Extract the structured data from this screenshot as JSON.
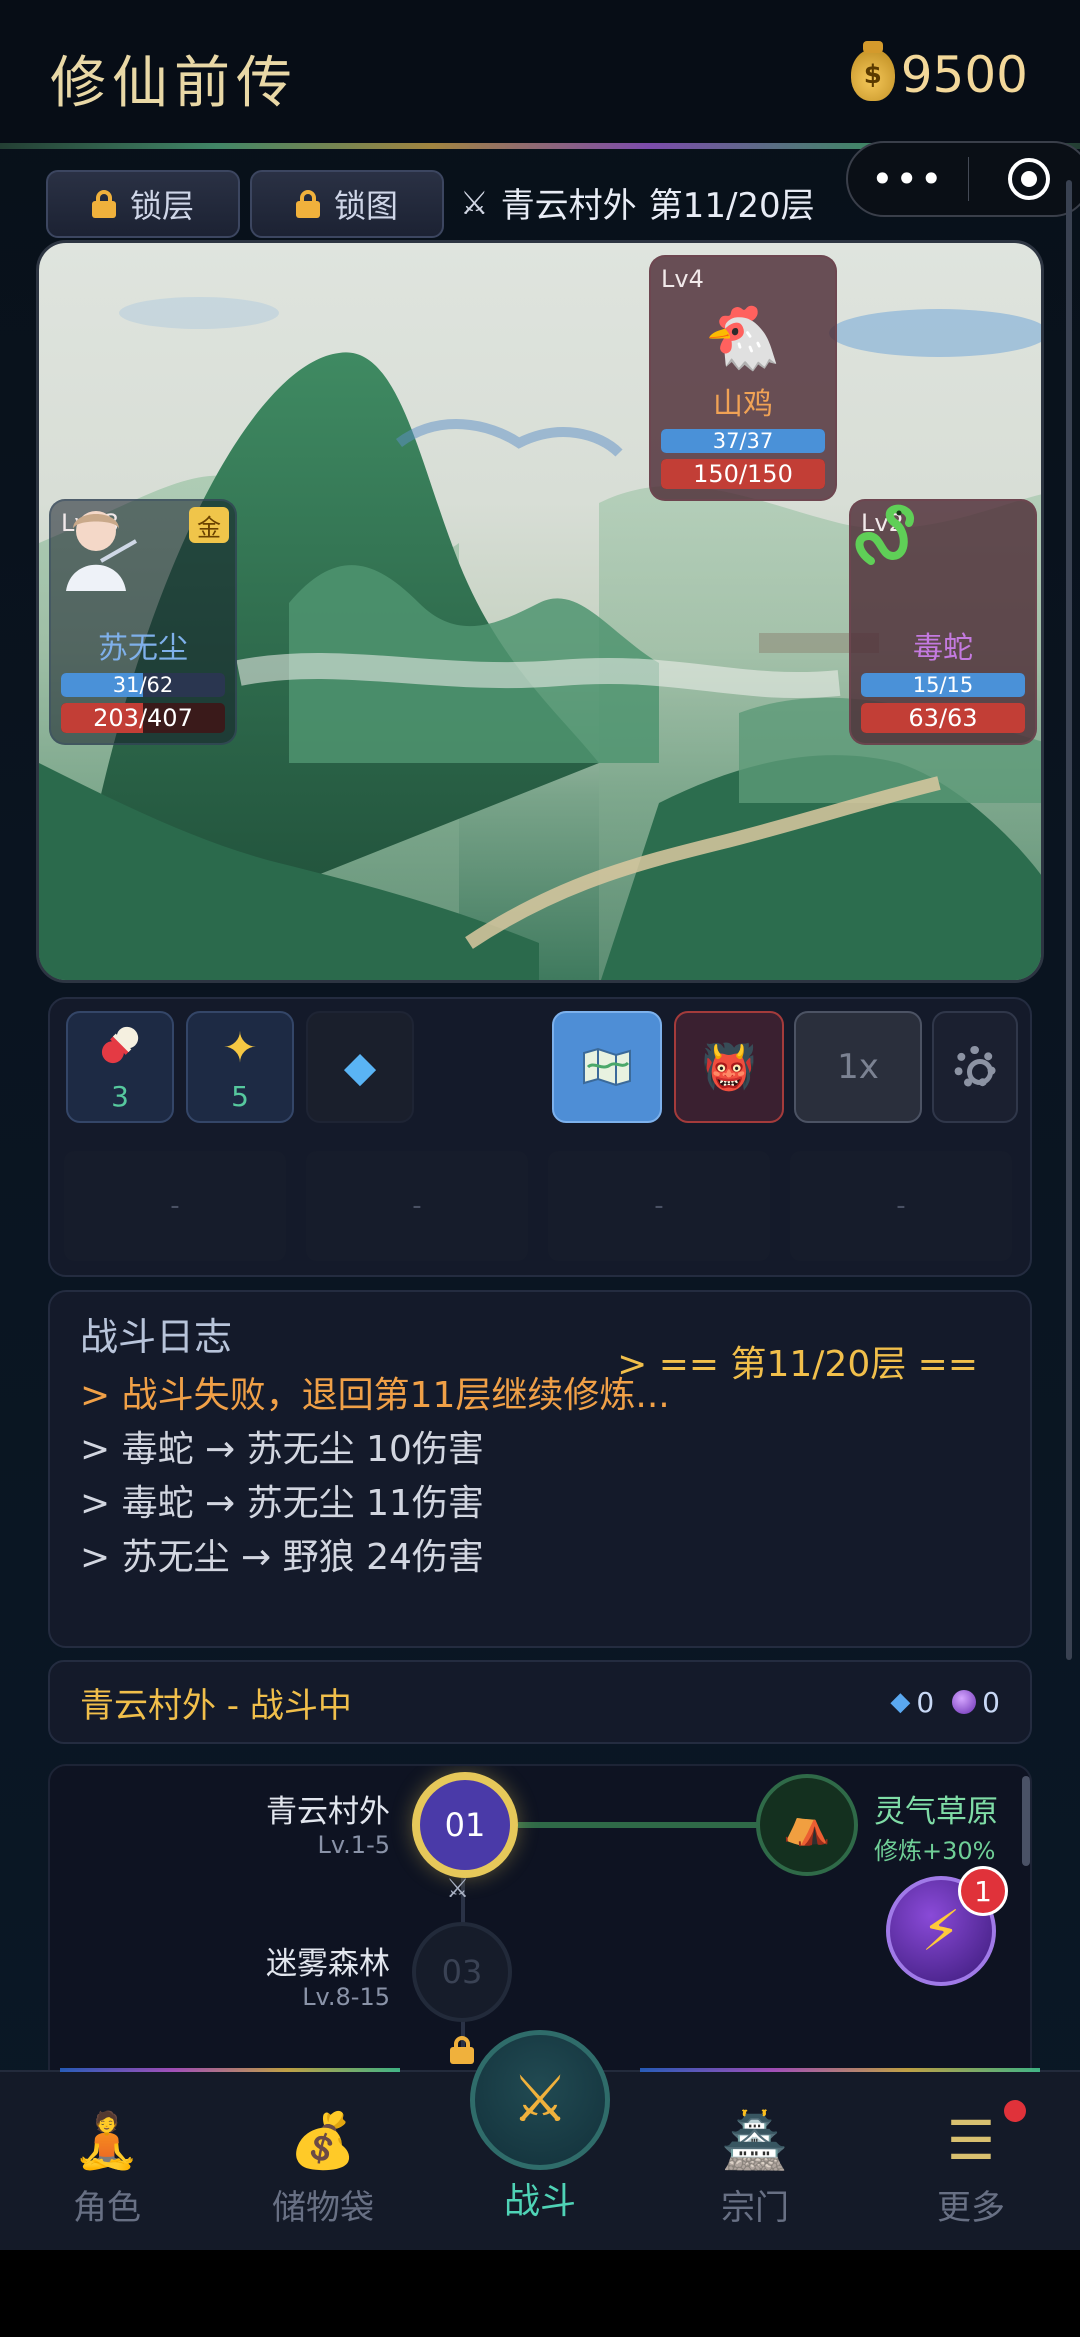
{
  "header": {
    "title": "修仙前传",
    "gold_value": "9500"
  },
  "toolbar": {
    "lock_floor_label": "锁层",
    "lock_map_label": "锁图",
    "location": "青云村外",
    "floor": "第11/20层"
  },
  "capsule": {
    "more_glyph": "•••"
  },
  "scene": {
    "hero": {
      "level": "Lv13",
      "badge": "金",
      "name": "苏无尘",
      "mp_text": "31/62",
      "mp_fraction": 0.5,
      "hp_text": "203/407",
      "hp_fraction": 0.5
    },
    "enemies": [
      {
        "level": "Lv4",
        "name": "山鸡",
        "icon": "🐔",
        "mp_text": "37/37",
        "mp_fraction": 1.0,
        "hp_text": "150/150",
        "hp_fraction": 1.0
      },
      {
        "level": "Lv2",
        "name": "毒蛇",
        "icon": "snake-icon",
        "mp_text": "15/15",
        "mp_fraction": 1.0,
        "hp_text": "63/63",
        "hp_fraction": 1.0
      }
    ]
  },
  "items": [
    {
      "icon": "pill-icon",
      "count": "3"
    },
    {
      "icon": "sparkle-icon",
      "count": "5"
    },
    {
      "icon": "diamond-icon",
      "count": ""
    }
  ],
  "controls": {
    "speed_label": "1x"
  },
  "slots": [
    "-",
    "-",
    "-",
    "-"
  ],
  "log": {
    "title": "战斗日志",
    "lines": [
      "> == 第11/20层 ==",
      "> 战斗失败，退回第11层继续修炼...",
      "> 毒蛇 → 苏无尘 10伤害",
      "> 毒蛇 → 苏无尘 11伤害",
      "> 苏无尘 → 野狼 24伤害"
    ]
  },
  "status": {
    "text": "青云村外 - 战斗中",
    "diamonds": "0",
    "orbs": "0"
  },
  "map": {
    "nodes": [
      {
        "name": "青云村外",
        "range": "Lv.1-5",
        "number": "01"
      },
      {
        "name": "迷雾森林",
        "range": "Lv.8-15",
        "number": "03"
      }
    ],
    "side_node": {
      "name": "灵气草原",
      "bonus": "修炼+30%"
    }
  },
  "float_button": {
    "badge": "1"
  },
  "nav": {
    "items": [
      "角色",
      "储物袋",
      "战斗",
      "宗门",
      "更多"
    ]
  },
  "colors": {
    "accent_gold": "#f1bf4b",
    "accent_teal": "#4fd3b6",
    "hp_red": "#c23e36",
    "mp_blue": "#4a91d8"
  }
}
